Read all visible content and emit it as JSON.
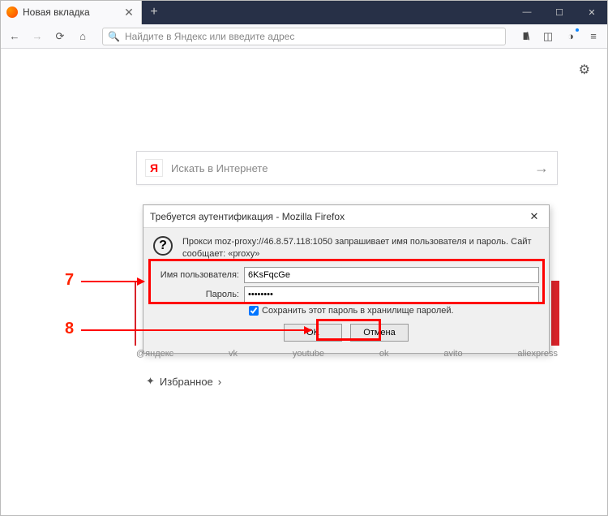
{
  "window": {
    "tab_title": "Новая вкладка",
    "newtab": "+",
    "min": "—",
    "max": "☐",
    "close": "✕"
  },
  "toolbar": {
    "url_placeholder": "Найдите в Яндекс или введите адрес"
  },
  "search": {
    "logo": "Я",
    "placeholder": "Искать в Интернете",
    "arrow": "→"
  },
  "quicklinks": [
    "@яндекс",
    "vk",
    "youtube",
    "ok",
    "avito",
    "aliexpress"
  ],
  "favorites": {
    "label": "Избранное",
    "chev": "›"
  },
  "dialog": {
    "title": "Требуется аутентификация - Mozilla Firefox",
    "message": "Прокси moz-proxy://46.8.57.118:1050 запрашивает имя пользователя и пароль. Сайт сообщает: «proxy»",
    "user_label": "Имя пользователя:",
    "user_value": "6KsFqcGe",
    "pass_label": "Пароль:",
    "pass_value": "••••••••",
    "save_label": "Сохранить этот пароль в хранилище паролей.",
    "ok": "OK",
    "cancel": "Отмена"
  },
  "anno": {
    "n7": "7",
    "n8": "8"
  }
}
